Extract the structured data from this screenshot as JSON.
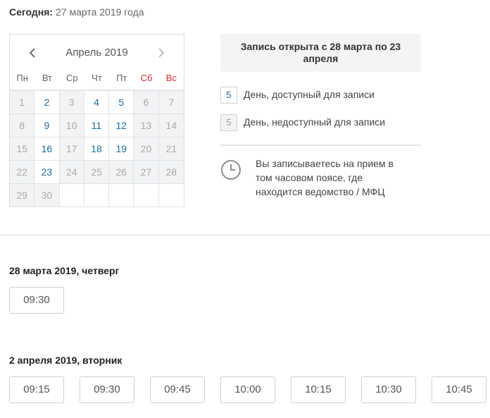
{
  "today": {
    "label": "Сегодня:",
    "value": "27 марта 2019 года"
  },
  "calendar": {
    "month": "Апрель 2019",
    "weekdays": [
      "Пн",
      "Вт",
      "Ср",
      "Чт",
      "Пт",
      "Сб",
      "Вс"
    ],
    "weekend_color": "#d62e36",
    "available_color": "#1a6ea6",
    "days": [
      {
        "d": "1",
        "state": "disabled"
      },
      {
        "d": "2",
        "state": "available"
      },
      {
        "d": "3",
        "state": "disabled"
      },
      {
        "d": "4",
        "state": "available"
      },
      {
        "d": "5",
        "state": "available"
      },
      {
        "d": "6",
        "state": "disabled"
      },
      {
        "d": "7",
        "state": "disabled"
      },
      {
        "d": "8",
        "state": "disabled"
      },
      {
        "d": "9",
        "state": "available"
      },
      {
        "d": "10",
        "state": "disabled"
      },
      {
        "d": "11",
        "state": "available"
      },
      {
        "d": "12",
        "state": "available"
      },
      {
        "d": "13",
        "state": "disabled"
      },
      {
        "d": "14",
        "state": "disabled"
      },
      {
        "d": "15",
        "state": "disabled"
      },
      {
        "d": "16",
        "state": "available"
      },
      {
        "d": "17",
        "state": "disabled"
      },
      {
        "d": "18",
        "state": "available"
      },
      {
        "d": "19",
        "state": "available"
      },
      {
        "d": "20",
        "state": "disabled"
      },
      {
        "d": "21",
        "state": "disabled"
      },
      {
        "d": "22",
        "state": "disabled"
      },
      {
        "d": "23",
        "state": "available"
      },
      {
        "d": "24",
        "state": "disabled"
      },
      {
        "d": "25",
        "state": "disabled"
      },
      {
        "d": "26",
        "state": "disabled"
      },
      {
        "d": "27",
        "state": "disabled"
      },
      {
        "d": "28",
        "state": "disabled"
      },
      {
        "d": "29",
        "state": "disabled"
      },
      {
        "d": "30",
        "state": "disabled"
      },
      {
        "d": "",
        "state": "empty"
      },
      {
        "d": "",
        "state": "empty"
      },
      {
        "d": "",
        "state": "empty"
      },
      {
        "d": "",
        "state": "empty"
      },
      {
        "d": "",
        "state": "empty"
      }
    ]
  },
  "info": {
    "banner": "Запись открыта с 28 марта по 23 апреля",
    "legend_available_num": "5",
    "legend_available": "День, доступный для записи",
    "legend_unavailable_num": "5",
    "legend_unavailable": "День, недоступный для записи",
    "timezone_note": "Вы записываетесь на прием в том часовом поясе, где находится ведомство / МФЦ"
  },
  "dates": [
    {
      "title": "28 марта 2019, четверг",
      "slots": [
        "09:30"
      ]
    },
    {
      "title": "2 апреля 2019, вторник",
      "slots": [
        "09:15",
        "09:30",
        "09:45",
        "10:00",
        "10:15",
        "10:30",
        "10:45"
      ]
    }
  ]
}
